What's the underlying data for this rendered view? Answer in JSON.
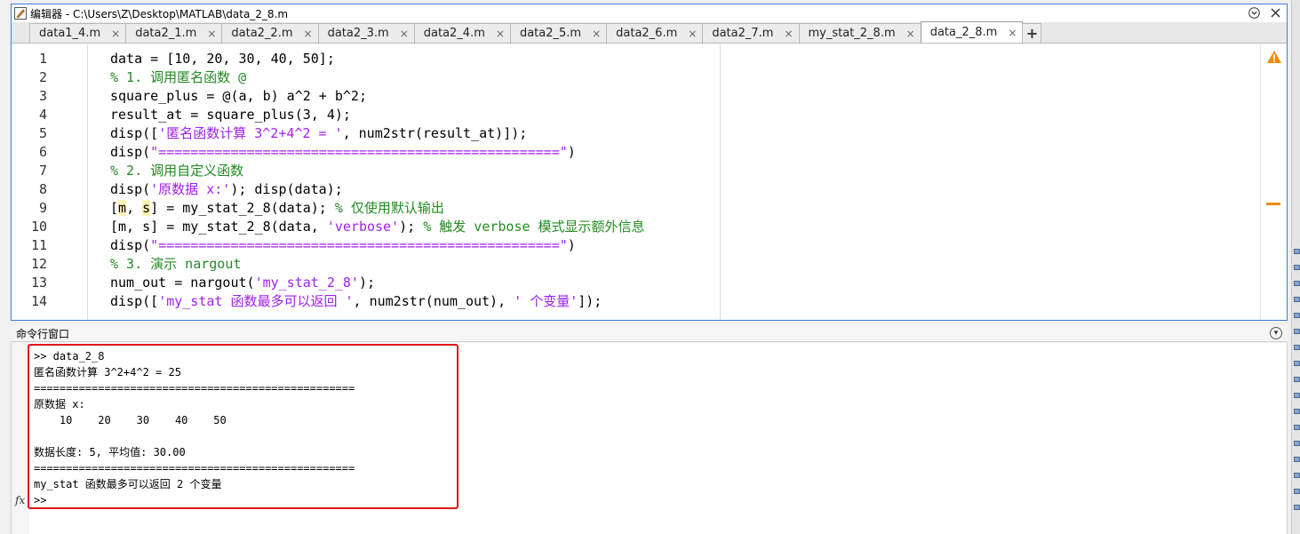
{
  "window": {
    "title": "编辑器 - C:\\Users\\Z\\Desktop\\MATLAB\\data_2_8.m"
  },
  "tabs": [
    {
      "label": "data1_4.m",
      "active": false
    },
    {
      "label": "data2_1.m",
      "active": false
    },
    {
      "label": "data2_2.m",
      "active": false
    },
    {
      "label": "data2_3.m",
      "active": false
    },
    {
      "label": "data2_4.m",
      "active": false
    },
    {
      "label": "data2_5.m",
      "active": false
    },
    {
      "label": "data2_6.m",
      "active": false
    },
    {
      "label": "data2_7.m",
      "active": false
    },
    {
      "label": "my_stat_2_8.m",
      "active": false
    },
    {
      "label": "data_2_8.m",
      "active": true
    }
  ],
  "tab_close_glyph": "×",
  "tab_add_glyph": "+",
  "code": {
    "line_numbers": [
      "1",
      "2",
      "3",
      "4",
      "5",
      "6",
      "7",
      "8",
      "9",
      "10",
      "11",
      "12",
      "13",
      "14"
    ],
    "lines": [
      [
        {
          "t": "data = [10, 20, 30, 40, 50];",
          "k": "n"
        }
      ],
      [
        {
          "t": "% 1. 调用匿名函数 @",
          "k": "c"
        }
      ],
      [
        {
          "t": "square_plus = @(a, b) a^2 + b^2;",
          "k": "n"
        }
      ],
      [
        {
          "t": "result_at = square_plus(3, 4);",
          "k": "n"
        }
      ],
      [
        {
          "t": "disp([",
          "k": "n"
        },
        {
          "t": "'匿名函数计算 3^2+4^2 = '",
          "k": "s"
        },
        {
          "t": ", num2str(result_at)]);",
          "k": "n"
        }
      ],
      [
        {
          "t": "disp(",
          "k": "n"
        },
        {
          "t": "\"==================================================\"",
          "k": "s"
        },
        {
          "t": ")",
          "k": "n"
        }
      ],
      [
        {
          "t": "% 2. 调用自定义函数",
          "k": "c"
        }
      ],
      [
        {
          "t": "disp(",
          "k": "n"
        },
        {
          "t": "'原数据 x:'",
          "k": "s"
        },
        {
          "t": "); disp(data);",
          "k": "n"
        }
      ],
      [
        {
          "t": "[",
          "k": "n"
        },
        {
          "t": "m",
          "k": "h"
        },
        {
          "t": ", ",
          "k": "n"
        },
        {
          "t": "s",
          "k": "h"
        },
        {
          "t": "] = my_stat_2_8(data); ",
          "k": "n"
        },
        {
          "t": "% 仅使用默认输出",
          "k": "c"
        }
      ],
      [
        {
          "t": "[m, s] = my_stat_2_8(data, ",
          "k": "n"
        },
        {
          "t": "'verbose'",
          "k": "s"
        },
        {
          "t": "); ",
          "k": "n"
        },
        {
          "t": "% 触发 verbose 模式显示额外信息",
          "k": "c"
        }
      ],
      [
        {
          "t": "disp(",
          "k": "n"
        },
        {
          "t": "\"==================================================\"",
          "k": "s"
        },
        {
          "t": ")",
          "k": "n"
        }
      ],
      [
        {
          "t": "% 3. 演示 nargout",
          "k": "c"
        }
      ],
      [
        {
          "t": "num_out = nargout(",
          "k": "n"
        },
        {
          "t": "'my_stat_2_8'",
          "k": "s"
        },
        {
          "t": ");",
          "k": "n"
        }
      ],
      [
        {
          "t": "disp([",
          "k": "n"
        },
        {
          "t": "'my_stat 函数最多可以返回 '",
          "k": "s"
        },
        {
          "t": ", num2str(num_out), ",
          "k": "n"
        },
        {
          "t": "' 个变量'",
          "k": "s"
        },
        {
          "t": "]);",
          "k": "n"
        }
      ]
    ]
  },
  "command_window": {
    "title": "命令行窗口",
    "output": [
      ">> data_2_8",
      "匿名函数计算 3^2+4^2 = 25",
      "==================================================",
      "原数据 x:",
      "    10    20    30    40    50",
      "",
      "数据长度: 5, 平均值: 30.00",
      "==================================================",
      "my_stat 函数最多可以返回 2 个变量",
      ">>"
    ],
    "fx_label": "fx"
  },
  "colors": {
    "accent_border": "#3d7fd1",
    "comment": "#228b22",
    "string": "#a020f0",
    "highlight_box": "#e0101a",
    "warning": "#f08a00"
  }
}
